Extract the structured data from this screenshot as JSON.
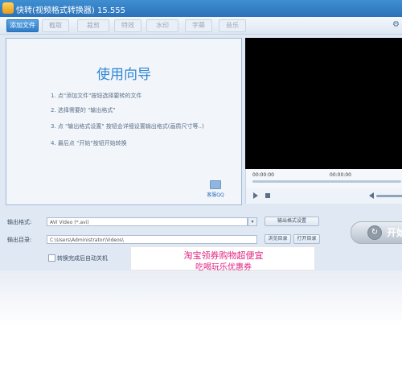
{
  "window": {
    "title": "快转(视频格式转换器) 15.555"
  },
  "toolbar": {
    "buttons": [
      "添加文件",
      "截取",
      "裁剪",
      "特效",
      "水印",
      "字幕",
      "音乐"
    ],
    "settings_icon": "gear-icon"
  },
  "guide": {
    "title": "使用向导",
    "steps": [
      "1. 点\"添加文件\"按钮选择要转的文件",
      "2. 选择需要的 \"输出格式\"",
      "3. 点 \"输出格式设置\" 按钮会详细设置输出格式(画质尺寸等..)",
      "4. 最后点 \"开始\"按钮开始转换"
    ],
    "help_label": "客服QQ"
  },
  "player": {
    "time_current": "00:00:00",
    "time_total": "00:00:00"
  },
  "output": {
    "format_label": "输出格式:",
    "format_value": "AVI Video (*.avi)",
    "format_settings_button": "输出格式设置",
    "dir_label": "输出目录:",
    "dir_value": "C:\\Users\\Administrator\\Videos\\",
    "browse_button": "浏览目录",
    "open_button": "打开目录",
    "shutdown_label": "转换完成后自动关机"
  },
  "ad": {
    "line1": "淘宝领券购物超便宜",
    "line2": "吃喝玩乐优惠券"
  },
  "start": {
    "label": "开始"
  }
}
